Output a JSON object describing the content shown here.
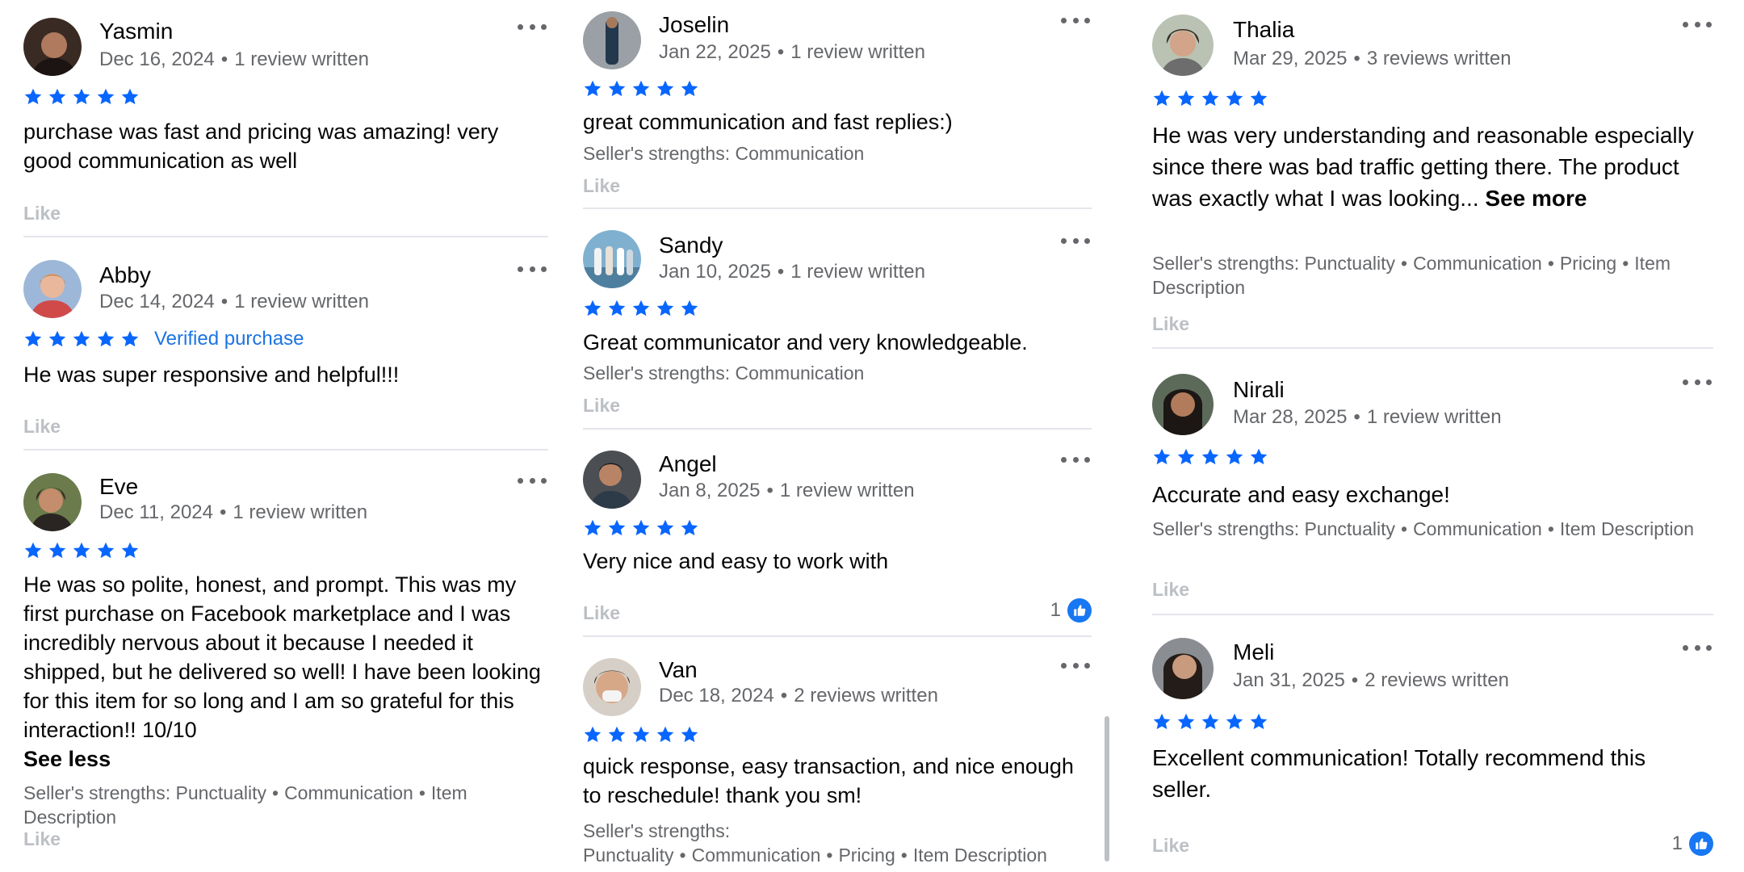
{
  "columns": [
    {
      "reviews": [
        {
          "name": "Yasmin",
          "date": "Dec 16, 2024",
          "written": "1 review written",
          "text": "purchase was fast and pricing was amazing! very good communication as well",
          "like": "Like"
        },
        {
          "name": "Abby",
          "date": "Dec 14, 2024",
          "written": "1 review written",
          "verified": "Verified purchase",
          "text": "He was super responsive and helpful!!!",
          "like": "Like"
        },
        {
          "name": "Eve",
          "date": "Dec 11, 2024",
          "written": "1 review written",
          "text": "He was so polite, honest, and prompt. This was my first purchase on Facebook marketplace and I was incredibly nervous about it because I needed it shipped, but he delivered so well! I have been looking for this item for so long and I am so grateful for this interaction!! 10/10",
          "see_less": "See less",
          "strengths_label": "Seller's strengths:",
          "strengths": [
            "Punctuality",
            "Communication",
            "Item Description"
          ],
          "like": "Like"
        }
      ]
    },
    {
      "reviews": [
        {
          "name": "Joselin",
          "date": "Jan 22, 2025",
          "written": "1 review written",
          "text": "great communication and fast replies:)",
          "strengths_label": "Seller's strengths:",
          "strengths": [
            "Communication"
          ],
          "like": "Like"
        },
        {
          "name": "Sandy",
          "date": "Jan 10, 2025",
          "written": "1 review written",
          "text": "Great communicator and very knowledgeable.",
          "strengths_label": "Seller's strengths:",
          "strengths": [
            "Communication"
          ],
          "like": "Like"
        },
        {
          "name": "Angel",
          "date": "Jan 8, 2025",
          "written": "1 review written",
          "text": "Very nice and easy to work with",
          "like": "Like",
          "like_count": "1"
        },
        {
          "name": "Van",
          "date": "Dec 18, 2024",
          "written": "2 reviews written",
          "text": "quick response, easy transaction, and nice enough to reschedule! thank you sm!",
          "strengths_label": "Seller's strengths:",
          "strengths": [
            "Punctuality",
            "Communication",
            "Pricing",
            "Item Description"
          ]
        }
      ]
    },
    {
      "reviews": [
        {
          "name": "Thalia",
          "date": "Mar 29, 2025",
          "written": "3 reviews written",
          "text": "He was very understanding and reasonable especially since there was bad traffic getting there. The product was exactly what I was looking...",
          "see_more": "See more",
          "strengths_label": "Seller's strengths:",
          "strengths": [
            "Punctuality",
            "Communication",
            "Pricing",
            "Item Description"
          ],
          "like": "Like"
        },
        {
          "name": "Nirali",
          "date": "Mar 28, 2025",
          "written": "1 review written",
          "text": "Accurate and easy exchange!",
          "strengths_label": "Seller's strengths:",
          "strengths": [
            "Punctuality",
            "Communication",
            "Item Description"
          ],
          "like": "Like"
        },
        {
          "name": "Meli",
          "date": "Jan 31, 2025",
          "written": "2 reviews written",
          "text": "Excellent communication! Totally recommend this seller.",
          "like": "Like",
          "like_count": "1"
        }
      ]
    }
  ],
  "rating_stars": 5,
  "icons": {
    "star": "star-icon",
    "more": "more-options-icon",
    "like_badge": "thumbs-up-icon"
  },
  "colors": {
    "star": "#0866ff",
    "verified": "#1b74e4",
    "like_badge": "#1877f2",
    "secondary_text": "#65676b",
    "like_text": "#bcc0c4"
  }
}
